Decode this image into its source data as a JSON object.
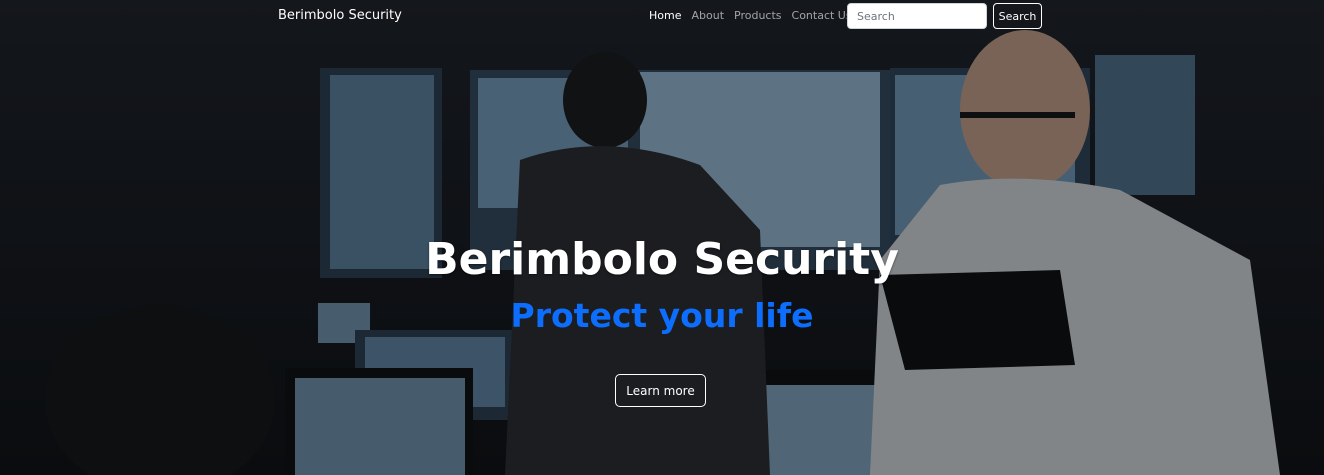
{
  "navbar": {
    "brand": "Berimbolo Security",
    "links": [
      {
        "label": "Home",
        "active": true
      },
      {
        "label": "About",
        "active": false
      },
      {
        "label": "Products",
        "active": false
      },
      {
        "label": "Contact Us",
        "active": false
      }
    ],
    "search": {
      "placeholder": "Search",
      "value": "",
      "button_label": "Search"
    }
  },
  "hero": {
    "title": "Berimbolo Security",
    "subtitle": "Protect your life",
    "cta_label": "Learn more",
    "accent_color": "#0d6efd"
  }
}
